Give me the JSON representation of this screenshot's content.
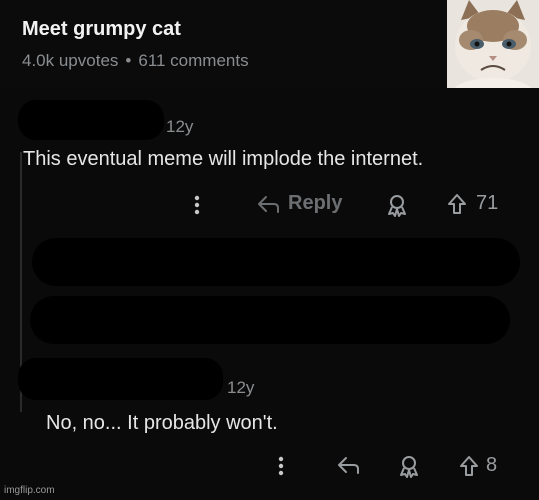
{
  "post": {
    "title": "Meet grumpy cat",
    "upvotes": "4.0k upvotes",
    "separator": "•",
    "comments": "611 comments"
  },
  "comment1": {
    "time": "12y",
    "text": "This eventual meme will implode the internet.",
    "reply_label": "Reply",
    "upvote_count": "71"
  },
  "comment2": {
    "time": "12y",
    "text": "No, no... It probably won't.",
    "upvote_count": "8"
  },
  "watermark": "imgflip.com",
  "icons": [
    "more-vertical-icon",
    "reply-arrow-icon",
    "award-icon",
    "upvote-arrow-icon"
  ]
}
